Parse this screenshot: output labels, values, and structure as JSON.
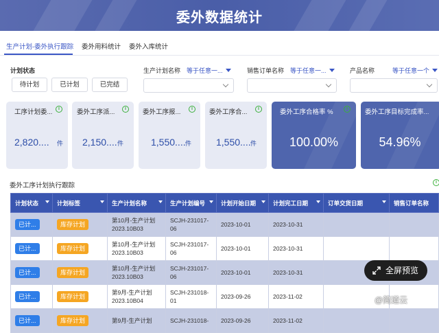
{
  "header": {
    "title": "委外数据统计"
  },
  "tabs": [
    {
      "label": "生产计划-委外执行跟踪",
      "active": true
    },
    {
      "label": "委外用料统计",
      "active": false
    },
    {
      "label": "委外入库统计",
      "active": false
    }
  ],
  "filters": {
    "status_label": "计划状态",
    "status_buttons": [
      "待计划",
      "已计划",
      "已完结"
    ],
    "plan_name": {
      "label": "生产计划名称",
      "operator": "等于任意一..."
    },
    "sales_order": {
      "label": "销售订单名称",
      "operator": "等于任意一..."
    },
    "product": {
      "label": "产品名称",
      "operator": "等于任意一个"
    }
  },
  "cards": [
    {
      "title": "工序计划委...",
      "value": "2,820....",
      "unit": "件"
    },
    {
      "title": "委外工序派...",
      "value": "2,150....",
      "unit": "件"
    },
    {
      "title": "委外工序报...",
      "value": "1,550....",
      "unit": "件"
    },
    {
      "title": "委外工序合...",
      "value": "1,550....",
      "unit": "件"
    },
    {
      "title": "委外工序合格率 %",
      "value": "100.00%"
    },
    {
      "title": "委外工序目标完成率...",
      "value": "54.96%"
    }
  ],
  "section": {
    "title": "委外工序计划执行跟踪"
  },
  "table": {
    "columns": [
      "计划状态",
      "计划标签",
      "生产计划名称",
      "生产计划编号",
      "计划开始日期",
      "计划完工日期",
      "订单交货日期",
      "销售订单名称"
    ],
    "rows": [
      {
        "status": "已计...",
        "tag": "库存计划",
        "name": "第10月-生产计划2023.10B03",
        "code": "SCJH-231017-06",
        "start": "2023-10-01",
        "end": "2023-10-31",
        "delivery": "",
        "order": ""
      },
      {
        "status": "已计...",
        "tag": "库存计划",
        "name": "第10月-生产计划2023.10B03",
        "code": "SCJH-231017-06",
        "start": "2023-10-01",
        "end": "2023-10-31",
        "delivery": "",
        "order": ""
      },
      {
        "status": "已计...",
        "tag": "库存计划",
        "name": "第10月-生产计划2023.10B03",
        "code": "SCJH-231017-06",
        "start": "2023-10-01",
        "end": "2023-10-31",
        "delivery": "",
        "order": ""
      },
      {
        "status": "已计...",
        "tag": "库存计划",
        "name": "第9月-生产计划2023.10B04",
        "code": "SCJH-231018-01",
        "start": "2023-09-26",
        "end": "2023-11-02",
        "delivery": "",
        "order": ""
      },
      {
        "status": "已计...",
        "tag": "库存计划",
        "name": "第9月-生产计划",
        "code": "SCJH-231018-",
        "start": "2023-09-26",
        "end": "2023-11-02",
        "delivery": "",
        "order": ""
      }
    ]
  },
  "fullscreen": {
    "label": "全屏预览"
  },
  "watermark": "@简道云",
  "colors": {
    "accent": "#3a56c5",
    "header_bg": "#4a5ea8",
    "card_dark": "#4f65ad",
    "badge_blue": "#2f7ee8",
    "badge_orange": "#f5a623"
  }
}
